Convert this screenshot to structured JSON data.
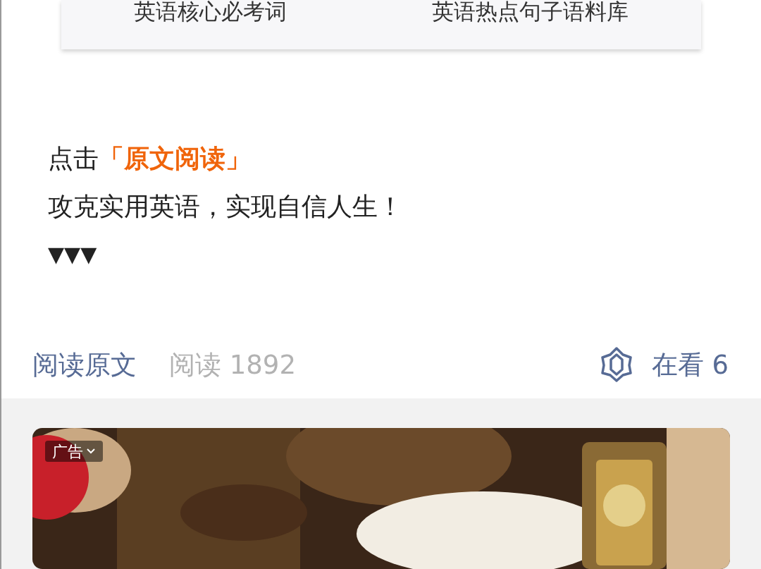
{
  "top_card": {
    "items": [
      "英语核心必考词",
      "英语热点句子语料库"
    ]
  },
  "article": {
    "prefix": "点击",
    "highlight": "「原文阅读」",
    "line_2": "攻克实用英语，实现自信人生！",
    "line_3": "▼▼▼"
  },
  "footer": {
    "read_original": "阅读原文",
    "reads": "阅读 1892",
    "watching": "在看 6"
  },
  "ad": {
    "label": "广告"
  }
}
